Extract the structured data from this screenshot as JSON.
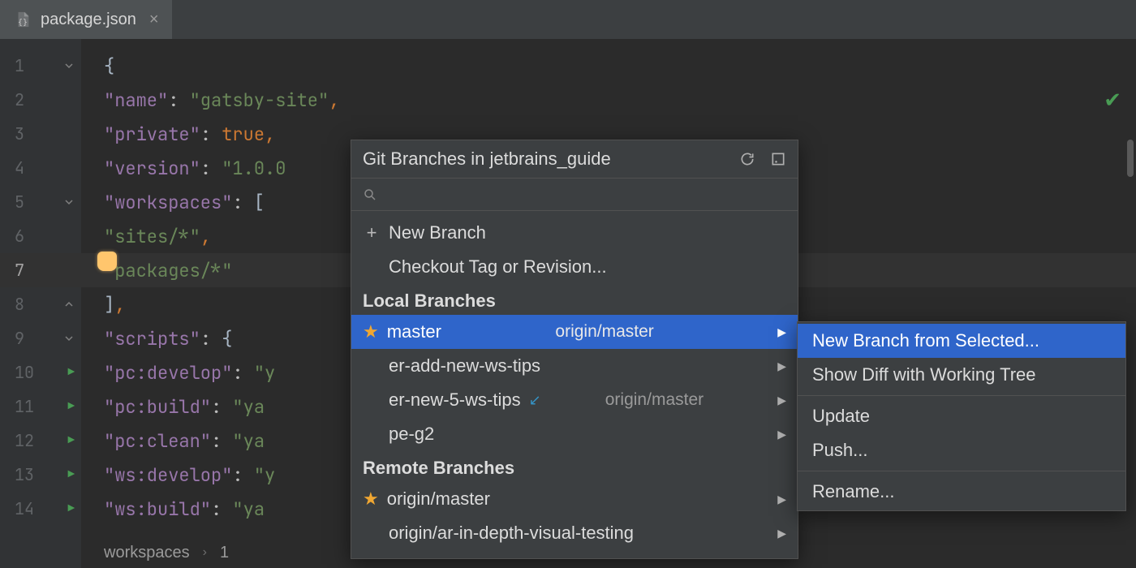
{
  "tab": {
    "filename": "package.json"
  },
  "breadcrumb": {
    "path1": "workspaces",
    "path2": "1"
  },
  "code": {
    "1": {
      "brace": "{"
    },
    "2": {
      "key": "\"name\"",
      "colon": ": ",
      "val": "\"gatsby-site\"",
      "comma": ","
    },
    "3": {
      "key": "\"private\"",
      "colon": ": ",
      "val": "true",
      "comma": ","
    },
    "4": {
      "key": "\"version\"",
      "colon": ": ",
      "val": "\"1.0.0"
    },
    "5": {
      "key": "\"workspaces\"",
      "colon": ": ",
      "bracket": "["
    },
    "6": {
      "val": "\"sites/*\"",
      "comma": ","
    },
    "7": {
      "val": "\"packages/*\""
    },
    "8": {
      "bracket": "]",
      "comma": ","
    },
    "9": {
      "key": "\"scripts\"",
      "colon": ": ",
      "brace": "{"
    },
    "10": {
      "key": "\"pc:develop\"",
      "colon": ": ",
      "val": "\"y"
    },
    "11": {
      "key": "\"pc:build\"",
      "colon": ": ",
      "val": "\"ya"
    },
    "12": {
      "key": "\"pc:clean\"",
      "colon": ": ",
      "val": "\"ya"
    },
    "13": {
      "key": "\"ws:develop\"",
      "colon": ": ",
      "val": "\"y"
    },
    "14": {
      "key": "\"ws:build\"",
      "colon": ": ",
      "val": "\"ya"
    }
  },
  "lineNumbers": [
    "1",
    "2",
    "3",
    "4",
    "5",
    "6",
    "7",
    "8",
    "9",
    "10",
    "11",
    "12",
    "13",
    "14"
  ],
  "popup": {
    "title": "Git Branches in jetbrains_guide",
    "newBranch": "New Branch",
    "checkoutTag": "Checkout Tag or Revision...",
    "localHeading": "Local Branches",
    "remoteHeading": "Remote Branches",
    "local": [
      {
        "name": "master",
        "track": "origin/master"
      },
      {
        "name": "er-add-new-ws-tips"
      },
      {
        "name": "er-new-5-ws-tips",
        "track": "origin/master",
        "incoming": true
      },
      {
        "name": "pe-g2"
      }
    ],
    "remote": [
      {
        "name": "origin/master"
      },
      {
        "name": "origin/ar-in-depth-visual-testing"
      }
    ]
  },
  "submenu": {
    "items": [
      "New Branch from Selected...",
      "Show Diff with Working Tree",
      "Update",
      "Push...",
      "Rename..."
    ]
  }
}
